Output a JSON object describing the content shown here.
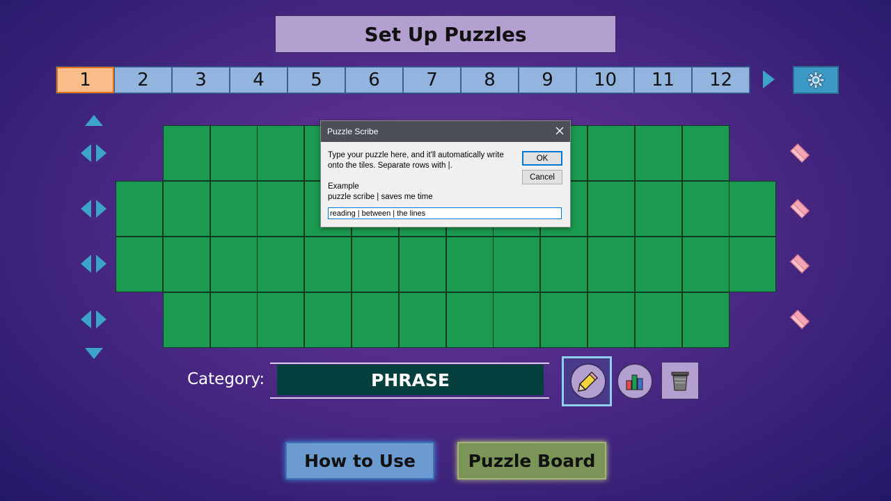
{
  "title": "Set Up Puzzles",
  "puzzle_tabs": [
    "1",
    "2",
    "3",
    "4",
    "5",
    "6",
    "7",
    "8",
    "9",
    "10",
    "11",
    "12"
  ],
  "active_tab": "1",
  "category": {
    "label": "Category:",
    "value": "PHRASE"
  },
  "buttons": {
    "how_to_use": "How to Use",
    "puzzle_board": "Puzzle Board"
  },
  "dialog": {
    "title": "Puzzle Scribe",
    "message_line1": "Type your puzzle here, and it'll automatically write",
    "message_line2": "onto the tiles. Separate rows with |.",
    "example_label": "Example",
    "example_text": "puzzle scribe | saves me time",
    "input_value": "reading | between | the lines",
    "ok": "OK",
    "cancel": "Cancel"
  },
  "icons": {
    "settings": "gear-icon",
    "pencil": "pencil-icon",
    "chart": "bar-chart-icon",
    "trash": "trash-icon",
    "eraser": "eraser-icon"
  },
  "colors": {
    "tile": "#1b9a51",
    "tab": "#92b4de",
    "tab_active": "#f9bd8b",
    "arrow": "#3ea3c9",
    "category_bg": "#053f3e"
  }
}
